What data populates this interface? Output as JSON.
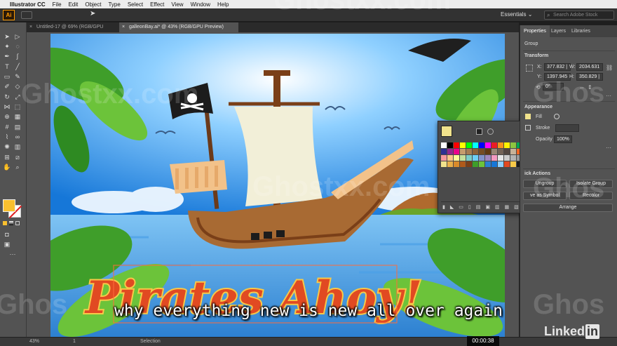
{
  "menubar": {
    "app_name": "Illustrator CC",
    "items": [
      "File",
      "Edit",
      "Object",
      "Type",
      "Select",
      "Effect",
      "View",
      "Window",
      "Help"
    ]
  },
  "header": {
    "logo": "Ai",
    "workspace": "Essentials",
    "search_placeholder": "Search Adobe Stock"
  },
  "tabs": [
    {
      "label": "Untitled-17 @ 69% (RGB/GPU Preview)",
      "active": false
    },
    {
      "label": "galleonBay.ai* @ 43% (RGB/GPU Preview)",
      "active": true
    }
  ],
  "panel": {
    "tabs": [
      "Properties",
      "Layers",
      "Libraries"
    ],
    "selection_type": "Group",
    "transform": {
      "title": "Transform",
      "x_label": "X:",
      "x_value": "377.832 |",
      "y_label": "Y:",
      "y_value": "1397.945",
      "w_label": "W:",
      "w_value": "2034.631",
      "h_label": "H:",
      "h_value": "350.829 |",
      "angle_value": "0°"
    },
    "appearance": {
      "title": "Appearance",
      "fill_label": "Fill",
      "stroke_label": "Stroke",
      "opacity_label": "Opacity",
      "opacity_value": "100%"
    },
    "quick_actions": {
      "title": "ick Actions",
      "buttons": [
        "Ungroup",
        "Isolate Group",
        "ve as Symbol",
        "Recolor",
        "Arrange"
      ]
    }
  },
  "status": {
    "zoom": "43%",
    "artboard": "1",
    "mode": "Selection"
  },
  "artwork": {
    "title": "Pirates Ahoy!"
  },
  "video": {
    "timecode": "00:00:38",
    "subtitle": "why everything new is new all over again",
    "brand": "Linked",
    "brand_in": "in"
  },
  "watermarks": [
    "Ghostxx.com",
    "Ghostxx.com",
    "Ghostxx.com",
    "Ghos",
    "Ghos",
    "Ghos",
    "Ghos"
  ],
  "colors": {
    "accent": "#ff9a00",
    "fill_swatch": "#f0e28c",
    "toolbar_fill": "#f9c02f"
  }
}
